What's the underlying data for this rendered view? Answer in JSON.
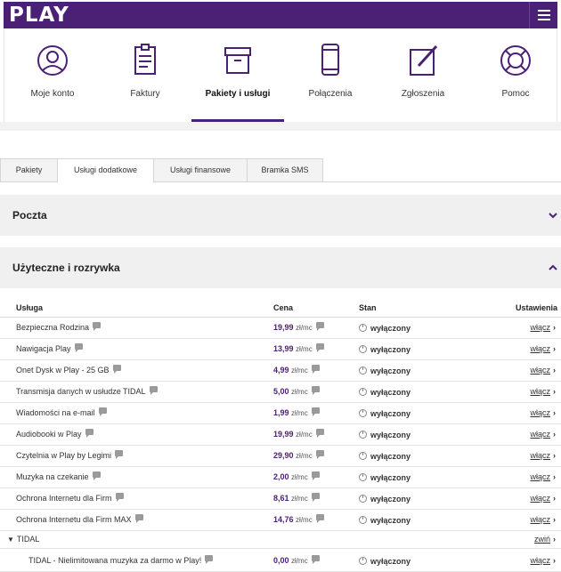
{
  "header": {
    "logo": "PLAY",
    "menu_icon": "hamburger-menu-icon"
  },
  "nav": {
    "items": [
      {
        "label": "Moje konto",
        "icon": "user-circle-icon"
      },
      {
        "label": "Faktury",
        "icon": "invoice-icon"
      },
      {
        "label": "Pakiety i usługi",
        "icon": "box-icon",
        "active": true
      },
      {
        "label": "Połączenia",
        "icon": "phone-icon"
      },
      {
        "label": "Zgłoszenia",
        "icon": "edit-icon"
      },
      {
        "label": "Pomoc",
        "icon": "lifebuoy-icon"
      }
    ]
  },
  "tabs": [
    {
      "label": "Pakiety"
    },
    {
      "label": "Usługi dodatkowe",
      "active": true
    },
    {
      "label": "Usługi finansowe"
    },
    {
      "label": "Bramka SMS"
    }
  ],
  "sections": {
    "poczta": {
      "title": "Poczta",
      "state": "collapsed"
    },
    "rozrywka": {
      "title": "Użyteczne i rozrywka",
      "state": "expanded"
    }
  },
  "table": {
    "headers": {
      "service": "Usługa",
      "price": "Cena",
      "state": "Stan",
      "settings": "Ustawienia"
    },
    "rows": [
      {
        "name": "Bezpieczna Rodzina",
        "price": "19,99",
        "unit": "zł/mc",
        "state": "wyłączony",
        "action": "włącz"
      },
      {
        "name": "Nawigacja Play",
        "price": "13,99",
        "unit": "zł/mc",
        "state": "wyłączony",
        "action": "włącz"
      },
      {
        "name": "Onet Dysk w Play - 25 GB",
        "price": "4,99",
        "unit": "zł/mc",
        "state": "wyłączony",
        "action": "włącz"
      },
      {
        "name": "Transmisja danych w usłudze TIDAL",
        "price": "5,00",
        "unit": "zł/mc",
        "state": "wyłączony",
        "action": "włącz"
      },
      {
        "name": "Wiadomości na e-mail",
        "price": "1,99",
        "unit": "zł/mc",
        "state": "wyłączony",
        "action": "włącz"
      },
      {
        "name": "Audiobooki w Play",
        "price": "19,99",
        "unit": "zł/mc",
        "state": "wyłączony",
        "action": "włącz"
      },
      {
        "name": "Czytelnia w Play by Legimi",
        "price": "29,90",
        "unit": "zł/mc",
        "state": "wyłączony",
        "action": "włącz"
      },
      {
        "name": "Muzyka na czekanie",
        "price": "2,00",
        "unit": "zł/mc",
        "state": "wyłączony",
        "action": "włącz"
      },
      {
        "name": "Ochrona Internetu dla Firm",
        "price": "8,61",
        "unit": "zł/mc",
        "state": "wyłączony",
        "action": "włącz"
      },
      {
        "name": "Ochrona Internetu dla Firm MAX",
        "price": "14,76",
        "unit": "zł/mc",
        "state": "wyłączony",
        "action": "włącz"
      }
    ],
    "group": {
      "name": "TIDAL",
      "action": "zwiń"
    },
    "group_rows": [
      {
        "name": "TIDAL - Nielimitowana muzyka za darmo w Play!",
        "price": "0,00",
        "unit": "zł/mc",
        "state": "wyłączony",
        "action": "włącz"
      }
    ]
  },
  "colors": {
    "brand": "#4b2176",
    "section_bg": "#f0f0f0"
  }
}
